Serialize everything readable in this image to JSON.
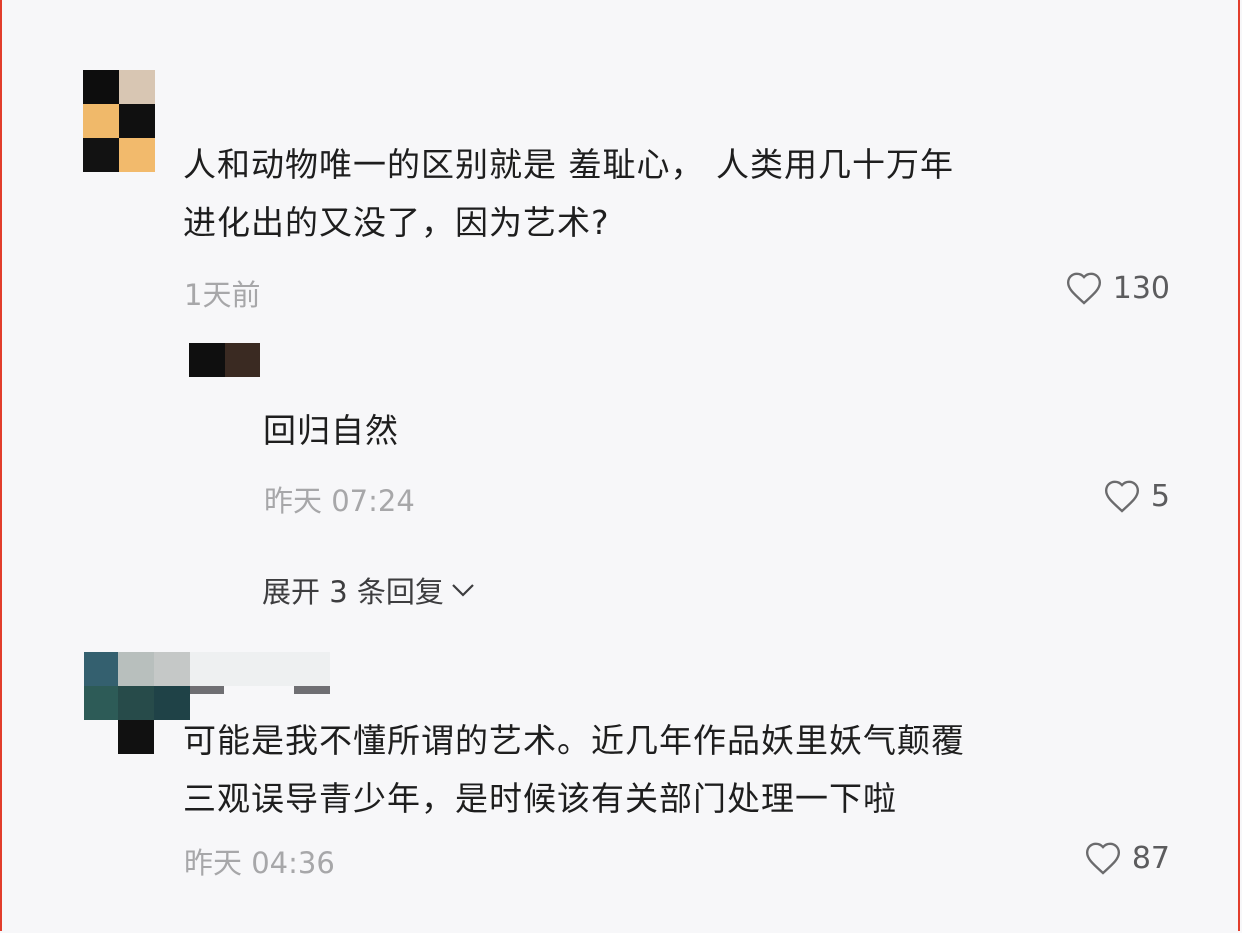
{
  "comments": [
    {
      "text_line1": "人和动物唯一的区别就是 羞耻心， 人类用几十万年",
      "text_line2": "进化出的又没了，因为艺术?",
      "time": "1天前",
      "likes": "130",
      "reply": {
        "text": "回归自然",
        "time": "昨天 07:24",
        "likes": "5"
      },
      "expand_label": "展开 3 条回复"
    },
    {
      "text_line1": "可能是我不懂所谓的艺术。近几年作品妖里妖气颠覆",
      "text_line2": "三观误导青少年，是时候该有关部门处理一下啦",
      "time": "昨天 04:36",
      "likes": "87"
    }
  ],
  "icons": {
    "like": "heart-outline-icon",
    "expand": "chevron-down-icon"
  },
  "colors": {
    "border": "#e23d2c",
    "meta": "#a7a7a9",
    "text": "#1e1e1e"
  }
}
